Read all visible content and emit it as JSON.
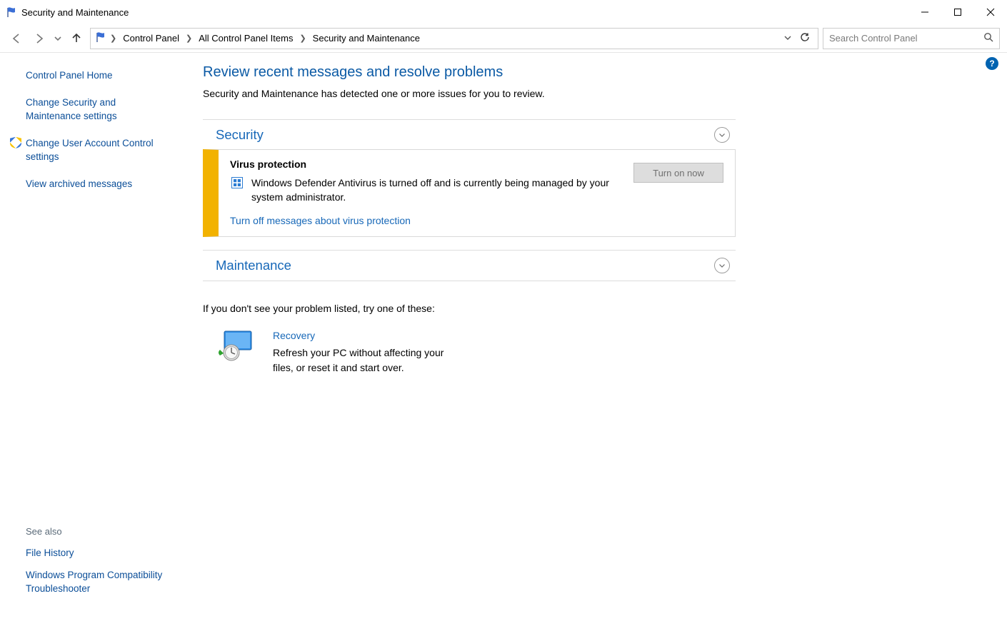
{
  "window": {
    "title": "Security and Maintenance"
  },
  "breadcrumb": {
    "items": [
      "Control Panel",
      "All Control Panel Items",
      "Security and Maintenance"
    ]
  },
  "search": {
    "placeholder": "Search Control Panel"
  },
  "sidebar": {
    "links": [
      {
        "label": "Control Panel Home",
        "shield": false
      },
      {
        "label": "Change Security and Maintenance settings",
        "shield": false
      },
      {
        "label": "Change User Account Control settings",
        "shield": true
      },
      {
        "label": "View archived messages",
        "shield": false
      }
    ],
    "see_also_header": "See also",
    "see_also": [
      "File History",
      "Windows Program Compatibility Troubleshooter"
    ]
  },
  "main": {
    "title": "Review recent messages and resolve problems",
    "subtitle": "Security and Maintenance has detected one or more issues for you to review.",
    "sections": {
      "security": {
        "title": "Security"
      },
      "maintenance": {
        "title": "Maintenance"
      }
    },
    "alert": {
      "title": "Virus protection",
      "message": "Windows Defender Antivirus is turned off and is currently being managed by your system administrator.",
      "link": "Turn off messages about virus protection",
      "button": "Turn on now"
    },
    "try_these": "If you don't see your problem listed, try one of these:",
    "recovery": {
      "title": "Recovery",
      "desc": "Refresh your PC without affecting your files, or reset it and start over."
    }
  },
  "help_glyph": "?"
}
